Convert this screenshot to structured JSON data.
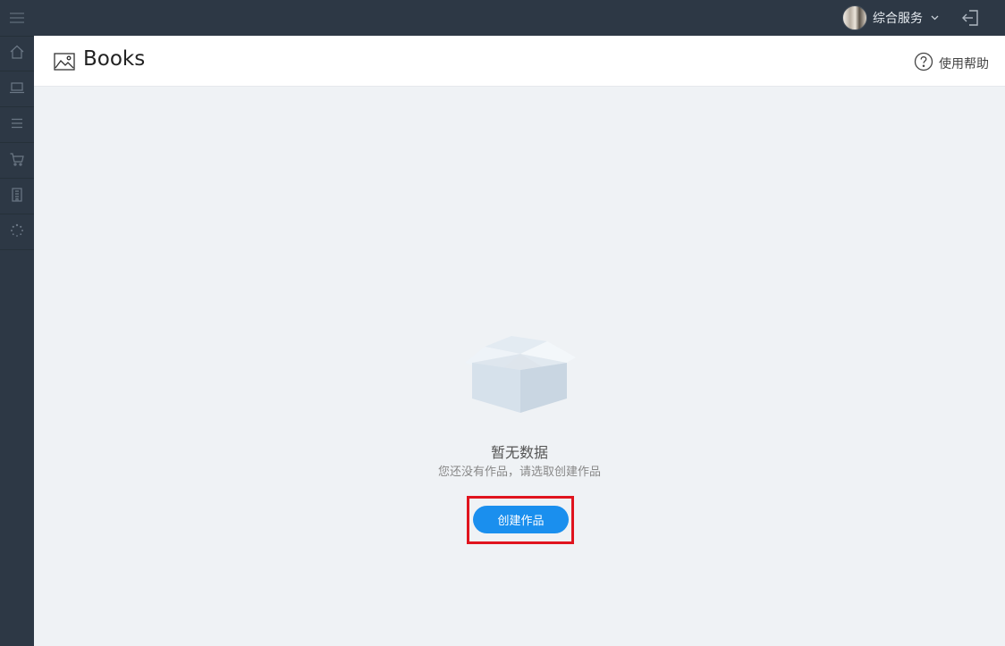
{
  "topbar": {
    "user_name": "综合服务",
    "icons": {
      "menu": "hamburger-menu-icon",
      "dropdown": "chevron-down-icon",
      "logout": "logout-icon"
    }
  },
  "sidebar": {
    "items": [
      {
        "icon": "home-icon"
      },
      {
        "icon": "laptop-icon"
      },
      {
        "icon": "list-icon"
      },
      {
        "icon": "cart-icon"
      },
      {
        "icon": "building-icon"
      },
      {
        "icon": "loading-spinner-icon"
      }
    ]
  },
  "header": {
    "title": "Books",
    "title_icon": "image-icon",
    "help_label": "使用帮助",
    "help_icon": "question-circle-icon"
  },
  "empty_state": {
    "icon": "empty-box-icon",
    "title": "暂无数据",
    "description": "您还没有作品，请选取创建作品",
    "button_label": "创建作品"
  },
  "colors": {
    "topbar_bg": "#2d3845",
    "content_bg": "#eff2f5",
    "primary_button": "#1a8fee",
    "highlight_border": "#e0141e"
  }
}
